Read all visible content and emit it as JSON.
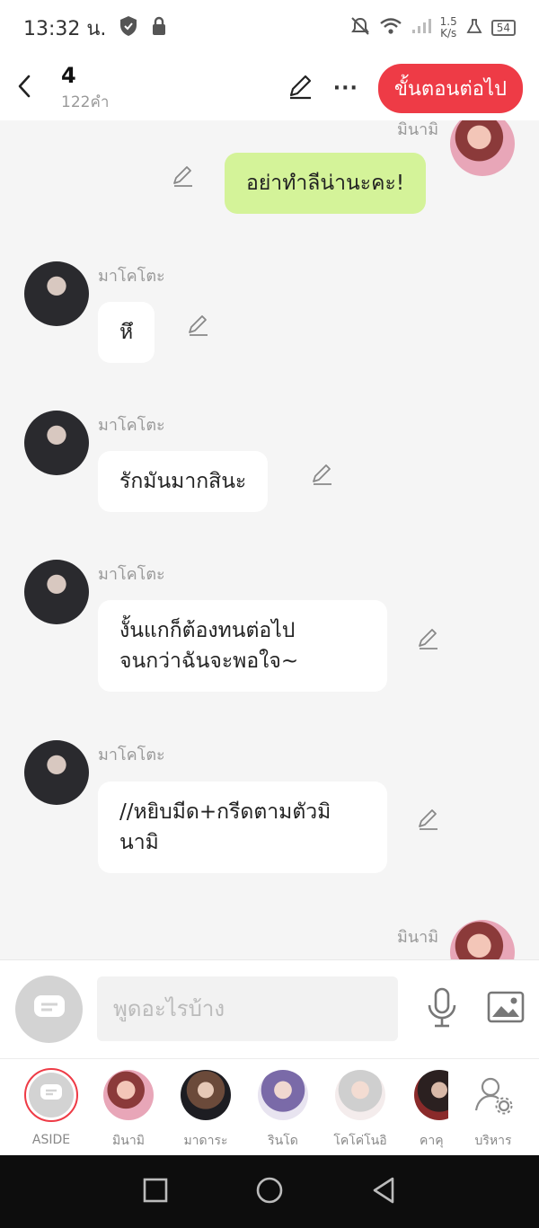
{
  "status_bar": {
    "time": "13:32 น.",
    "speed_value": "1.5",
    "speed_unit": "K/s",
    "battery": "54"
  },
  "header": {
    "chapter": "4",
    "word_count": "122คำ",
    "next_label": "ขั้นตอนต่อไป"
  },
  "messages": [
    {
      "speaker": "มินามิ",
      "text": "อย่าทำลีน่านะคะ!",
      "side": "right"
    },
    {
      "speaker": "มาโคโตะ",
      "text": "หึ",
      "side": "left"
    },
    {
      "speaker": "มาโคโตะ",
      "text": "รักมันมากสินะ",
      "side": "left"
    },
    {
      "speaker": "มาโคโตะ",
      "line1": "งั้นแกก็ต้องทนต่อไป",
      "line2": "จนกว่าฉันจะพอใจ~",
      "side": "left"
    },
    {
      "speaker": "มาโคโตะ",
      "line1": "//หยิบมีด+กรีดตามตัวมิ",
      "line2": "นามิ",
      "side": "left"
    },
    {
      "speaker": "มินามิ",
      "side": "right"
    }
  ],
  "input": {
    "placeholder": "พูดอะไรบ้าง"
  },
  "characters": [
    {
      "label": "ASIDE",
      "selected": true
    },
    {
      "label": "มินามิ"
    },
    {
      "label": "มาดาระ"
    },
    {
      "label": "รินโด"
    },
    {
      "label": "โคโค่โนอิ"
    },
    {
      "label": "คาคุ"
    },
    {
      "label": "บริหาร"
    }
  ],
  "colors": {
    "accent": "#ee3b46",
    "my_bubble": "#d4f399",
    "other_bubble": "#ffffff",
    "background": "#f5f5f5"
  },
  "icons": [
    "back-icon",
    "pencil-icon",
    "more-icon",
    "edit-icon",
    "chat-bubble-icon",
    "mic-icon",
    "image-icon",
    "manage-icon",
    "nav-square-icon",
    "nav-circle-icon",
    "nav-back-icon"
  ]
}
